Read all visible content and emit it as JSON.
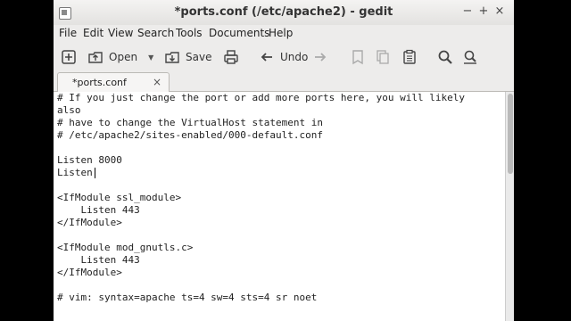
{
  "window": {
    "title": "*ports.conf (/etc/apache2) - gedit",
    "controls": {
      "minimize": "−",
      "maximize": "+",
      "close": "×"
    }
  },
  "menu": [
    "File",
    "Edit",
    "View",
    "Search",
    "Tools",
    "Documents",
    "Help"
  ],
  "toolbar": {
    "open_label": "Open",
    "save_label": "Save",
    "undo_label": "Undo"
  },
  "tab": {
    "label": "*ports.conf",
    "close": "×"
  },
  "editor": {
    "lines": [
      "# If you just change the port or add more ports here, you will likely",
      "also",
      "# have to change the VirtualHost statement in",
      "# /etc/apache2/sites-enabled/000-default.conf",
      "",
      "Listen 8000",
      "Listen",
      "",
      "<IfModule ssl_module>",
      "    Listen 443",
      "</IfModule>",
      "",
      "<IfModule mod_gnutls.c>",
      "    Listen 443",
      "</IfModule>",
      "",
      "# vim: syntax=apache ts=4 sw=4 sts=4 sr noet"
    ]
  }
}
